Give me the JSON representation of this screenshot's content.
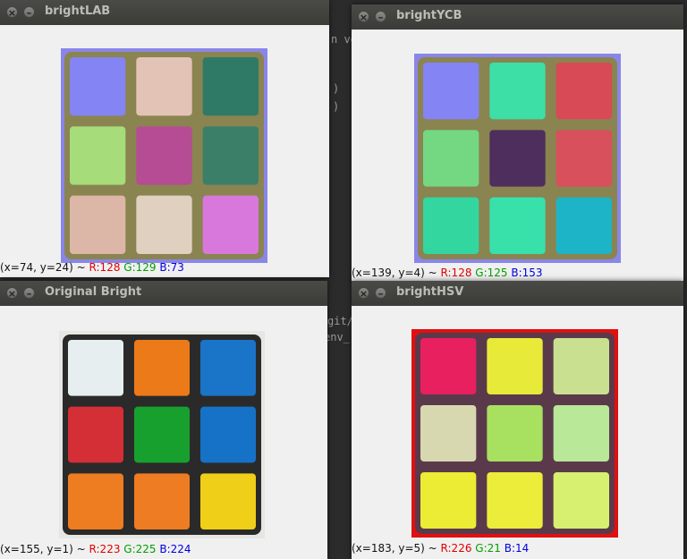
{
  "windows": {
    "lab": {
      "title": "brightLAB",
      "status": {
        "coords": "(x=74, y=24) ~",
        "r": "R:128",
        "g": "G:129",
        "b": "B:73"
      }
    },
    "ycb": {
      "title": "brightYCB",
      "status": {
        "coords": "(x=139, y=4) ~",
        "r": "R:128",
        "g": "G:125",
        "b": "B:153"
      }
    },
    "orig": {
      "title": "Original Bright",
      "status": {
        "coords": "(x=155, y=1) ~",
        "r": "R:223",
        "g": "G:225",
        "b": "B:224"
      }
    },
    "hsv": {
      "title": "brightHSV",
      "status": {
        "coords": "(x=183, y=5) ~",
        "r": "R:226",
        "g": "G:21",
        "b": "B:14"
      }
    }
  },
  "terminal": {
    "fragments": [
      "n ve",
      ")",
      ")",
      "git/",
      "env_"
    ]
  },
  "controls": {
    "close_glyph": "×",
    "min_glyph": "–"
  },
  "cubes": {
    "lab": {
      "bg": "#8a86e8",
      "frame": "#8a8450",
      "cells": [
        "#8484f4",
        "#e3c3b6",
        "#2f7a66",
        "#a6dc7a",
        "#b54c94",
        "#3b7f68",
        "#dcb6a6",
        "#e0d0c0",
        "#d878dc"
      ]
    },
    "ycb": {
      "bg": "#8a86e8",
      "frame": "#8a8450",
      "cells": [
        "#8484f4",
        "#3ddfa6",
        "#d84a55",
        "#74d882",
        "#4e2e5c",
        "#d8505c",
        "#34d6a0",
        "#38e0aa",
        "#1cb4c6"
      ]
    },
    "orig": {
      "bg": "#e6e6e3",
      "frame": "#2a2a2a",
      "cells": [
        "#e6eef0",
        "#ec7a18",
        "#1a74c8",
        "#d42e36",
        "#18a02e",
        "#1672c6",
        "#ee7c20",
        "#ee7c22",
        "#efcf18"
      ]
    },
    "hsv": {
      "bg": "#e01010",
      "frame": "#5a3a4a",
      "cells": [
        "#e82060",
        "#e8ea3a",
        "#c8e090",
        "#d8d8b0",
        "#a8e060",
        "#b8e898",
        "#ecec34",
        "#ecec3a",
        "#d8f070"
      ]
    }
  }
}
